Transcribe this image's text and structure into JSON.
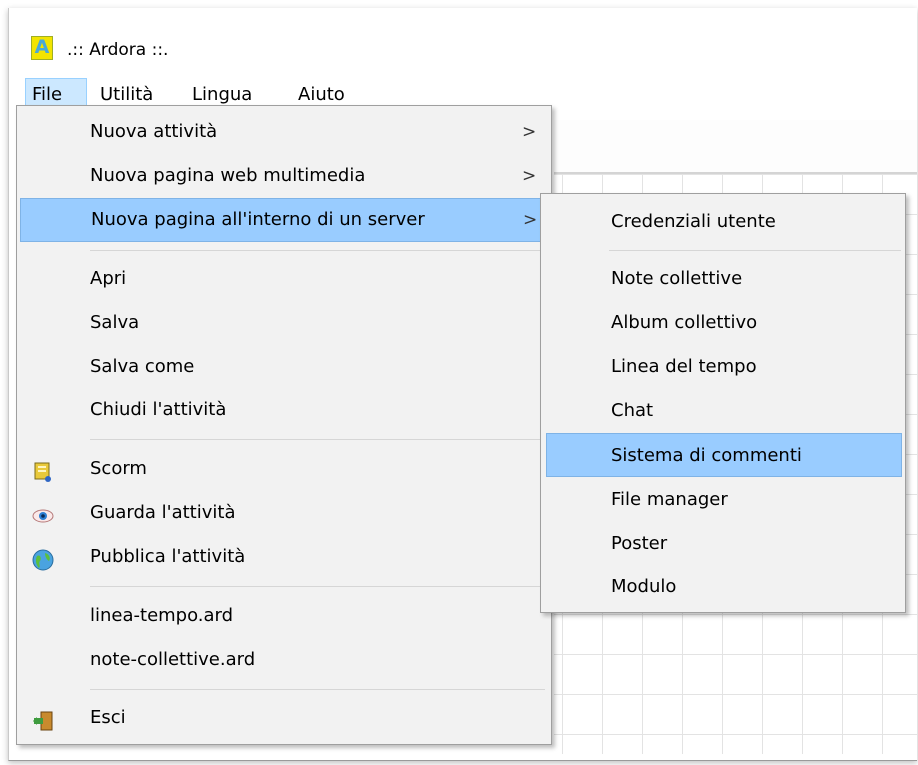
{
  "window": {
    "title": ".:: Ardora ::.",
    "logo_letter": "A"
  },
  "menubar": {
    "items": [
      "File",
      "Utilità",
      "Lingua",
      "Aiuto"
    ],
    "active": "File"
  },
  "file_menu": {
    "items": [
      {
        "label": "Nuova attività",
        "submenu": true,
        "icon": ""
      },
      {
        "label": "Nuova pagina web multimedia",
        "submenu": true,
        "icon": ""
      },
      {
        "label": "Nuova pagina all'interno di un server",
        "submenu": true,
        "icon": "",
        "highlighted": true
      },
      {
        "label": "Apri",
        "icon": ""
      },
      {
        "label": "Salva",
        "icon": ""
      },
      {
        "label": "Salva come",
        "icon": ""
      },
      {
        "label": "Chiudi l'attività",
        "icon": ""
      },
      {
        "label": "Scorm",
        "icon": "package-icon"
      },
      {
        "label": "Guarda l'attività",
        "icon": "eye-icon"
      },
      {
        "label": "Pubblica l'attività",
        "icon": "globe-icon"
      },
      {
        "label": "linea-tempo.ard",
        "icon": ""
      },
      {
        "label": "note-collettive.ard",
        "icon": ""
      },
      {
        "label": "Esci",
        "icon": "exit-door-icon"
      }
    ],
    "arrow": ">"
  },
  "server_submenu": {
    "items": [
      {
        "label": "Credenziali utente"
      },
      {
        "label": "Note collettive"
      },
      {
        "label": "Album collettivo"
      },
      {
        "label": "Linea del tempo"
      },
      {
        "label": "Chat"
      },
      {
        "label": "Sistema di commenti",
        "highlighted": true
      },
      {
        "label": "File manager"
      },
      {
        "label": "Poster"
      },
      {
        "label": "Modulo"
      }
    ]
  },
  "colors": {
    "highlight": "#99ccff",
    "menubar_active": "#cce8ff",
    "menu_bg": "#f2f2f2"
  }
}
